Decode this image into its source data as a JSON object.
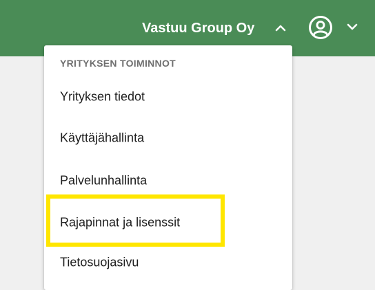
{
  "header": {
    "company_name": "Vastuu Group Oy",
    "brand_color": "#4a8c56",
    "company_toggle_icon": "chevron-up-icon",
    "user_icon": "user-circle-icon",
    "user_toggle_icon": "chevron-down-icon"
  },
  "dropdown": {
    "section_title": "YRITYKSEN TOIMINNOT",
    "items": [
      {
        "label": "Yrityksen tiedot"
      },
      {
        "label": "Käyttäjähallinta"
      },
      {
        "label": "Palvelunhallinta"
      },
      {
        "label": "Rajapinnat ja lisenssit",
        "highlighted": true
      },
      {
        "label": "Tietosuojasivu"
      }
    ],
    "highlight_color": "#ffe600"
  }
}
